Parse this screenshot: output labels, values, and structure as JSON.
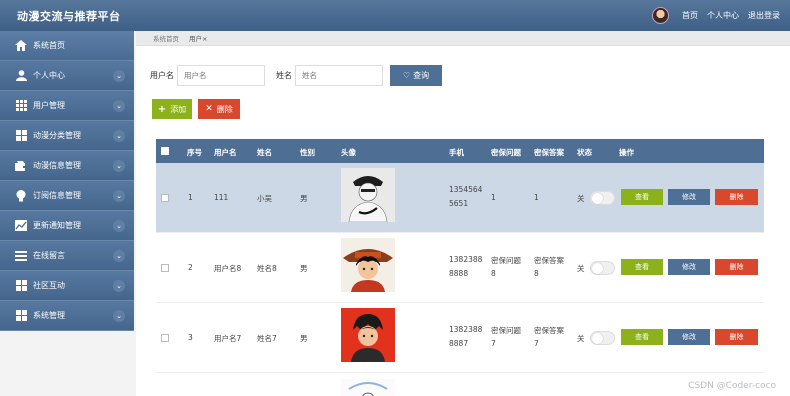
{
  "app": {
    "title": "动漫交流与推荐平台"
  },
  "topnav": {
    "home": "首页",
    "profile": "个人中心",
    "logout": "退出登录"
  },
  "sidebar": {
    "items": [
      {
        "label": "系统首页",
        "icon": "home-icon"
      },
      {
        "label": "个人中心",
        "icon": "user-icon"
      },
      {
        "label": "用户管理",
        "icon": "grid-icon"
      },
      {
        "label": "动漫分类管理",
        "icon": "grid-icon"
      },
      {
        "label": "动漫信息管理",
        "icon": "wallet-icon"
      },
      {
        "label": "订阅信息管理",
        "icon": "bulb-icon"
      },
      {
        "label": "更新通知管理",
        "icon": "chart-icon"
      },
      {
        "label": "在线留言",
        "icon": "list-icon"
      },
      {
        "label": "社区互动",
        "icon": "grid-icon"
      },
      {
        "label": "系统管理",
        "icon": "grid-icon"
      }
    ]
  },
  "breadcrumb": {
    "home": "系统首页",
    "current": "用户×"
  },
  "search": {
    "username_label": "用户名",
    "username_placeholder": "用户名",
    "name_label": "姓名",
    "name_placeholder": "姓名",
    "query_label": "查询"
  },
  "toolbar": {
    "add_label": "添加",
    "delete_label": "删除"
  },
  "table": {
    "headers": {
      "seq": "序号",
      "username": "用户名",
      "name": "姓名",
      "gender": "性别",
      "avatar": "头像",
      "phone": "手机",
      "question": "密保问题",
      "answer": "密保答案",
      "status": "状态",
      "actions": "操作"
    },
    "rows": [
      {
        "seq": "1",
        "username": "111",
        "name": "小吴",
        "gender": "男",
        "phone1": "1354564",
        "phone2": "5651",
        "question1": "1",
        "question2": "",
        "answer1": "1",
        "answer2": "",
        "status": "关"
      },
      {
        "seq": "2",
        "username": "用户名8",
        "name": "姓名8",
        "gender": "男",
        "phone1": "1382388",
        "phone2": "8888",
        "question1": "密保问题",
        "question2": "8",
        "answer1": "密保答案",
        "answer2": "8",
        "status": "关"
      },
      {
        "seq": "3",
        "username": "用户名7",
        "name": "姓名7",
        "gender": "男",
        "phone1": "1382388",
        "phone2": "8887",
        "question1": "密保问题",
        "question2": "7",
        "answer1": "密保答案",
        "answer2": "7",
        "status": "关"
      }
    ],
    "actions": {
      "view": "查看",
      "edit": "修改",
      "delete": "删除"
    }
  },
  "watermark": "CSDN @Coder-coco",
  "colors": {
    "header": "#4e6e93",
    "sidebar": "#476a91",
    "green": "#8db11a",
    "red": "#d9472c",
    "selected_row": "#cdd8e7"
  }
}
